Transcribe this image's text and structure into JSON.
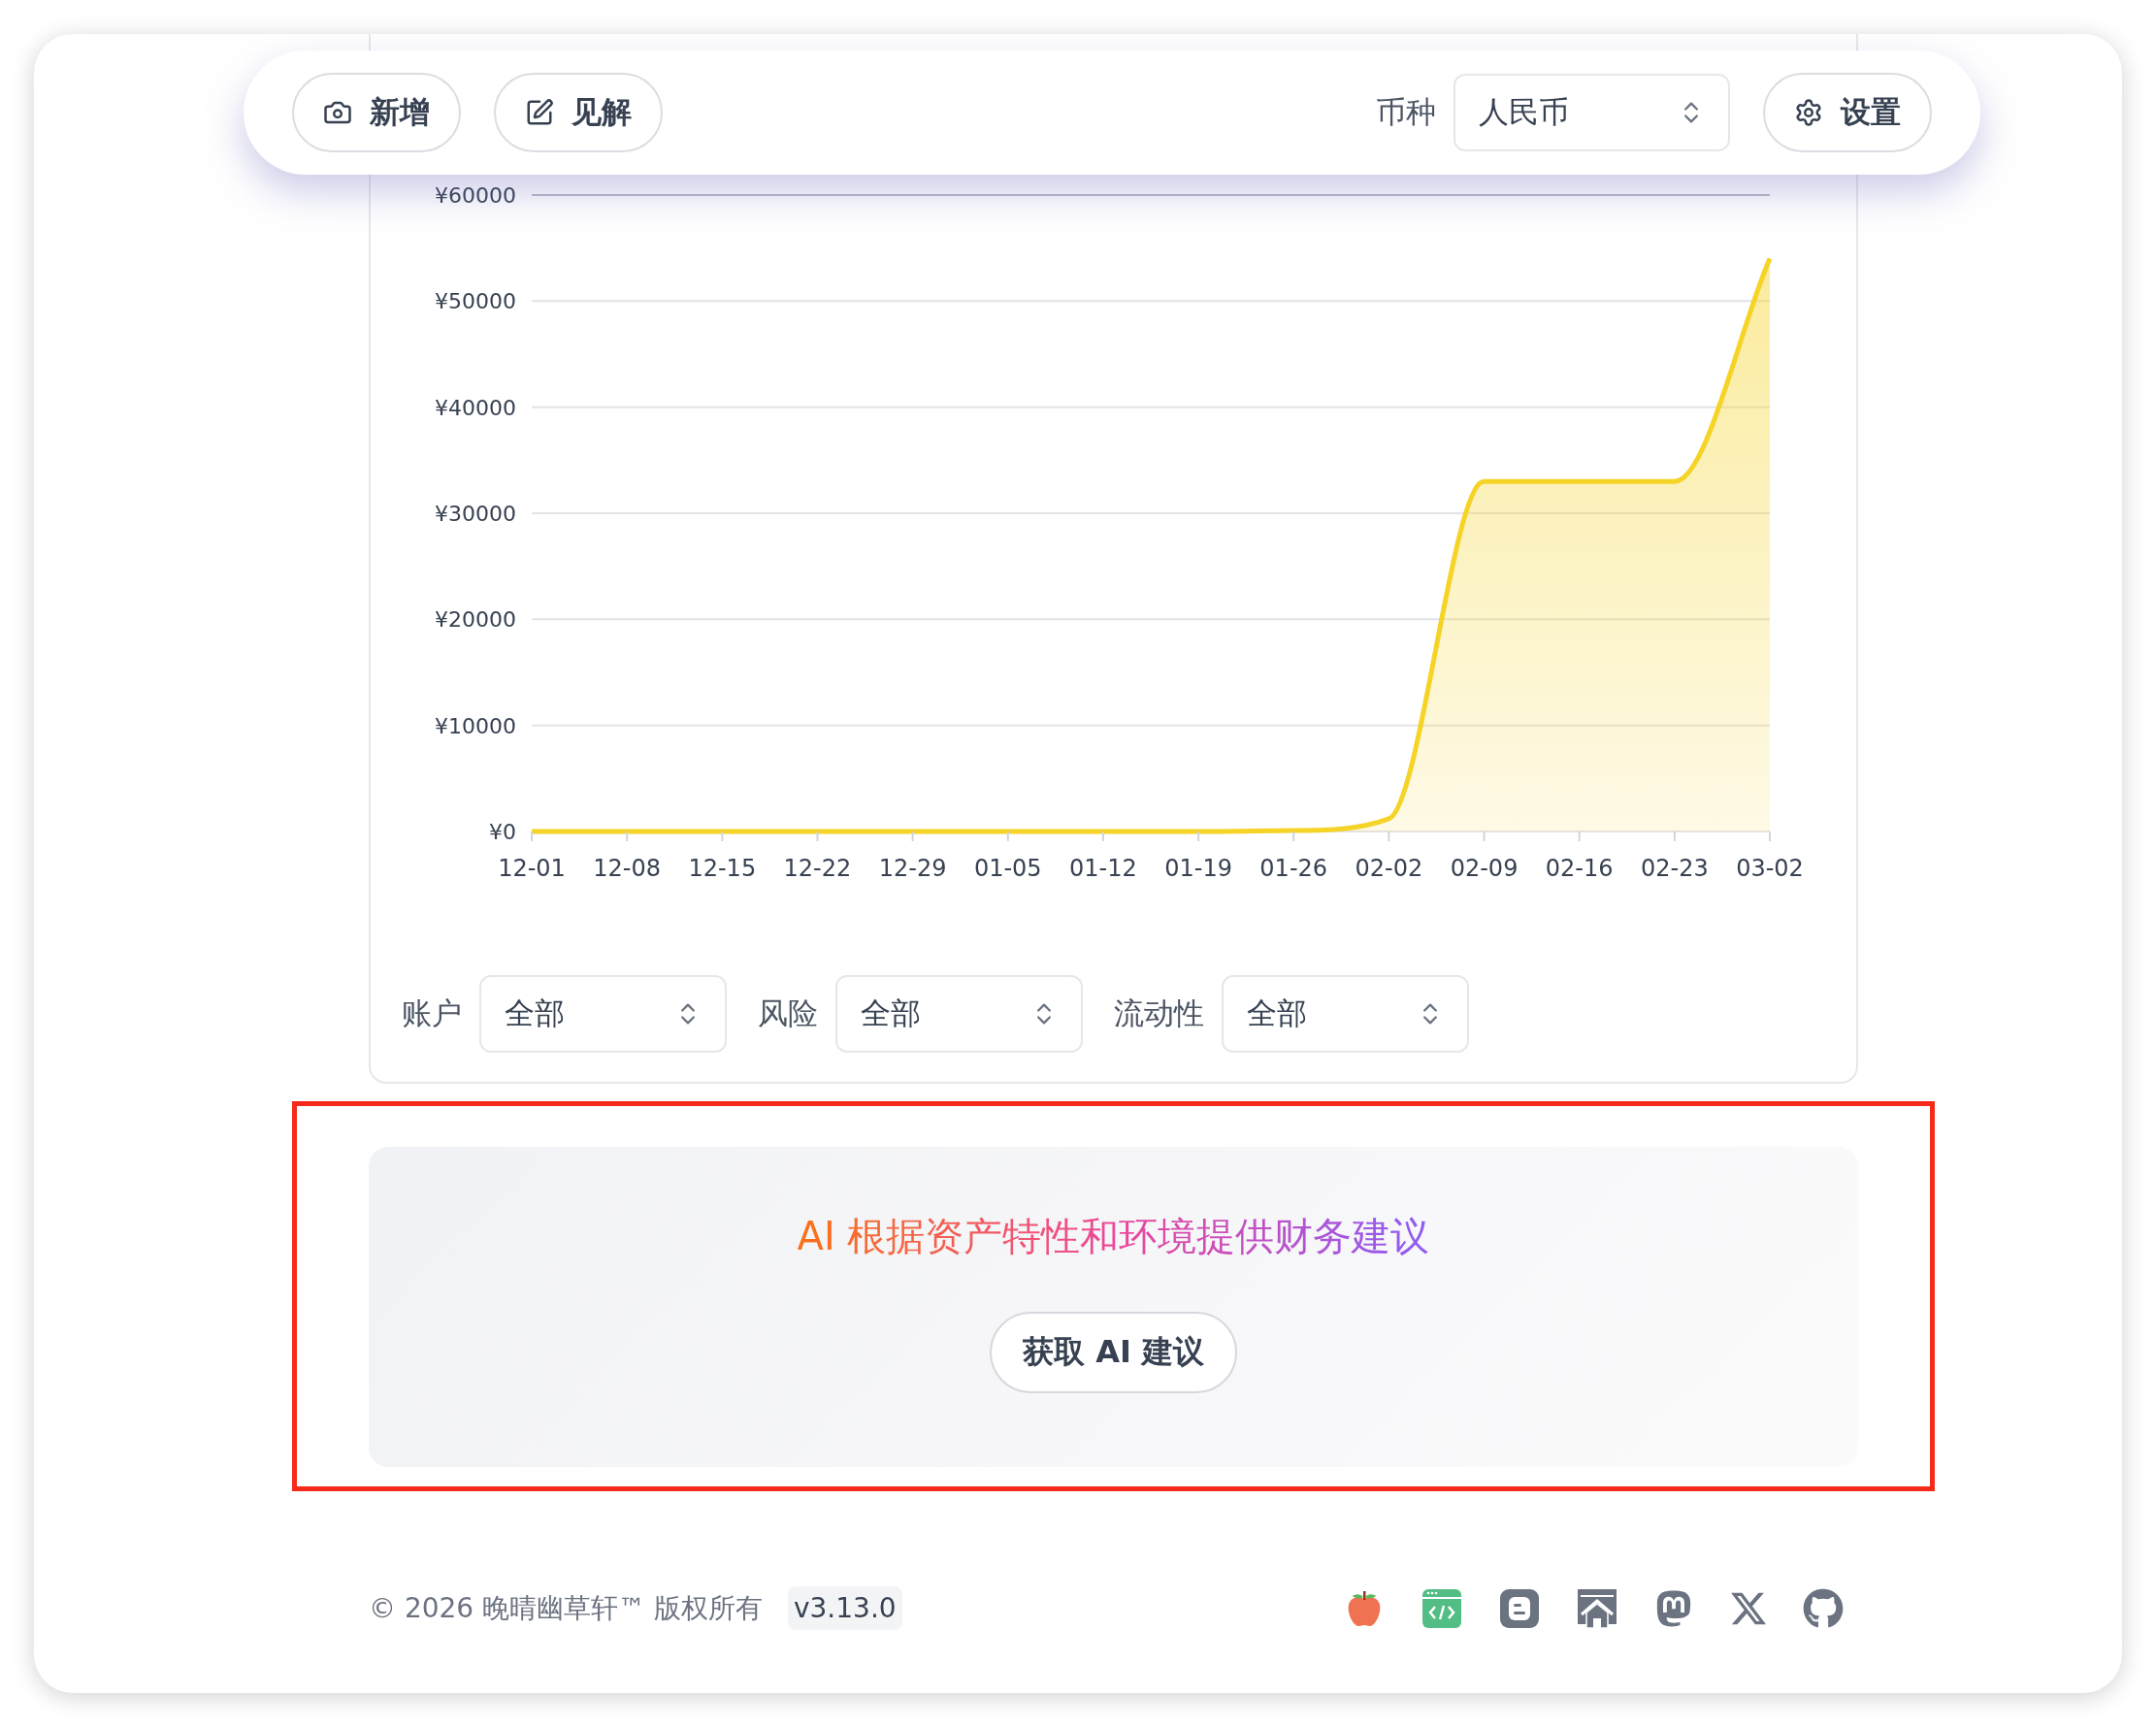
{
  "toolbar": {
    "buttons": [
      {
        "label": "新增"
      },
      {
        "label": "见解"
      }
    ],
    "currency": {
      "label": "币种",
      "value": "人民币"
    },
    "settings": {
      "label": "设置"
    }
  },
  "chart": {
    "chart_data": {
      "type": "area",
      "grid": true,
      "categories": [
        "12-01",
        "12-08",
        "12-15",
        "12-22",
        "12-29",
        "01-05",
        "01-12",
        "01-19",
        "01-26",
        "02-02",
        "02-09",
        "02-16",
        "02-23",
        "03-02"
      ],
      "series": [
        {
          "color": "#f5d327",
          "values": [
            0,
            0,
            0,
            0,
            0,
            0,
            0,
            0,
            100,
            1200,
            33000,
            33000,
            33000,
            54000
          ]
        }
      ],
      "ylim": [
        0,
        60000
      ],
      "yticks": [
        {
          "value": 0,
          "label": "¥0"
        },
        {
          "value": 10000,
          "label": "¥10000"
        },
        {
          "value": 20000,
          "label": "¥20000"
        },
        {
          "value": 30000,
          "label": "¥30000"
        },
        {
          "value": 40000,
          "label": "¥40000"
        },
        {
          "value": 50000,
          "label": "¥50000"
        },
        {
          "value": 60000,
          "label": "¥60000"
        }
      ]
    },
    "filters": [
      {
        "label": "账户",
        "value": "全部"
      },
      {
        "label": "风险",
        "value": "全部"
      },
      {
        "label": "流动性",
        "value": "全部"
      }
    ]
  },
  "ai_panel": {
    "headline": "AI 根据资产特性和环境提供财务建议",
    "button": "获取 AI 建议"
  },
  "footer": {
    "copyright": "© 2026 晚晴幽草轩™ 版权所有",
    "version": "v3.13.0"
  }
}
